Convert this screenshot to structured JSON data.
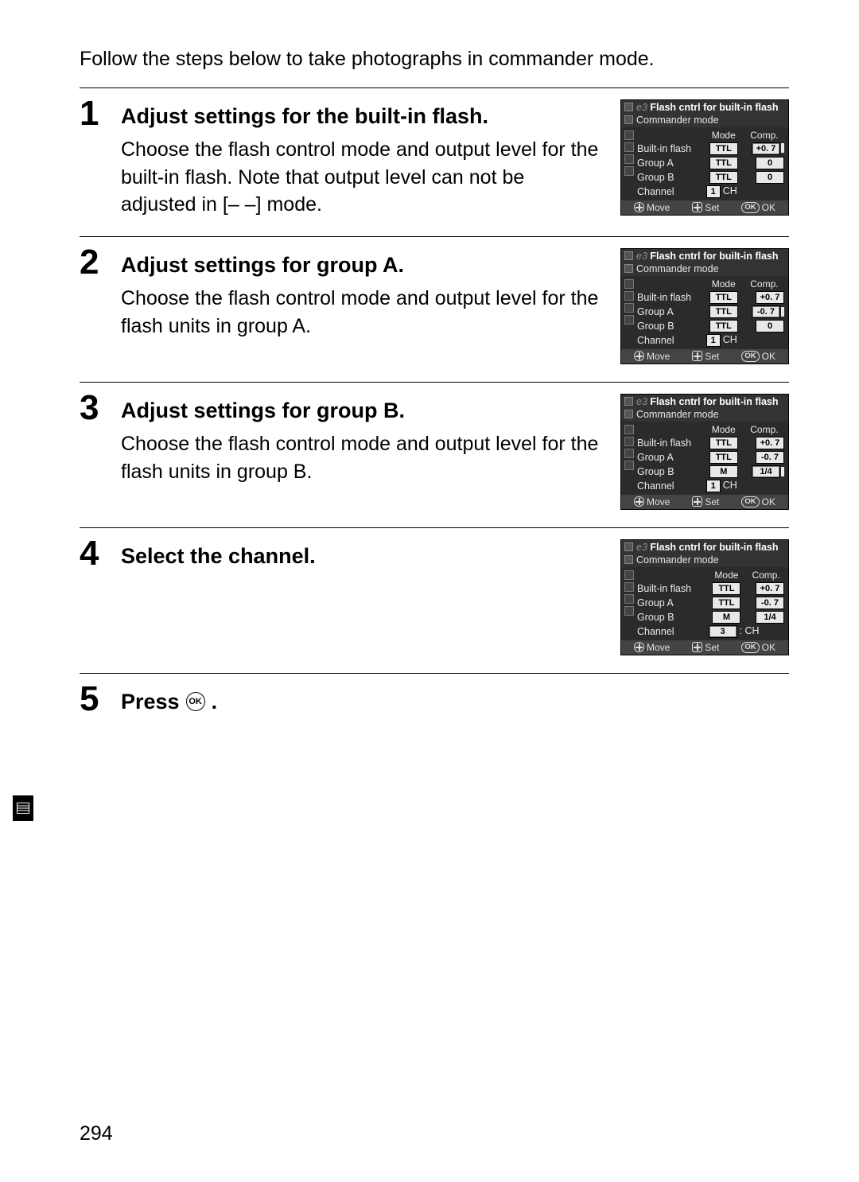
{
  "intro": "Follow the steps below to take photographs in commander mode.",
  "page_number": "294",
  "steps": [
    {
      "num": "1",
      "title": "Adjust settings for the built-in flash.",
      "desc": "Choose the flash control mode and output level for the built-in flash.  Note that output level can not be adjusted in [– –] mode.",
      "menu": {
        "title_prefix": "e3",
        "title_main": "Flash cntrl for built-in flash",
        "crumb": "Commander mode",
        "headers": [
          "Mode",
          "Comp."
        ],
        "rows": [
          {
            "label": "Built-in flash",
            "mode": "TTL",
            "comp": "+0. 7",
            "highlight": "comp",
            "cursor": true
          },
          {
            "label": "Group A",
            "mode": "TTL",
            "comp": "0"
          },
          {
            "label": "Group B",
            "mode": "TTL",
            "comp": "0"
          }
        ],
        "channel_label": "Channel",
        "channel_value": "1",
        "channel_suffix": "CH",
        "status": {
          "move": "Move",
          "set": "Set",
          "ok": "OK"
        }
      }
    },
    {
      "num": "2",
      "title": "Adjust settings for group A.",
      "desc": "Choose the flash control mode and output level for the flash units in group A.",
      "menu": {
        "title_prefix": "e3",
        "title_main": "Flash cntrl for built-in flash",
        "crumb": "Commander mode",
        "headers": [
          "Mode",
          "Comp."
        ],
        "rows": [
          {
            "label": "Built-in flash",
            "mode": "TTL",
            "comp": "+0. 7"
          },
          {
            "label": "Group A",
            "mode": "TTL",
            "comp": "-0. 7",
            "highlight": "comp",
            "cursor": true
          },
          {
            "label": "Group B",
            "mode": "TTL",
            "comp": "0"
          }
        ],
        "channel_label": "Channel",
        "channel_value": "1",
        "channel_suffix": "CH",
        "status": {
          "move": "Move",
          "set": "Set",
          "ok": "OK"
        }
      }
    },
    {
      "num": "3",
      "title": "Adjust settings for group B.",
      "desc": "Choose the flash control mode and output level for the flash units in group B.",
      "menu": {
        "title_prefix": "e3",
        "title_main": "Flash cntrl for built-in flash",
        "crumb": "Commander mode",
        "headers": [
          "Mode",
          "Comp."
        ],
        "rows": [
          {
            "label": "Built-in flash",
            "mode": "TTL",
            "comp": "+0. 7"
          },
          {
            "label": "Group A",
            "mode": "TTL",
            "comp": "-0. 7"
          },
          {
            "label": "Group B",
            "mode": "M",
            "comp": "1/4",
            "highlight": "comp",
            "cursor": true
          }
        ],
        "channel_label": "Channel",
        "channel_value": "1",
        "channel_suffix": "CH",
        "status": {
          "move": "Move",
          "set": "Set",
          "ok": "OK"
        }
      }
    },
    {
      "num": "4",
      "title": "Select the channel.",
      "desc": "",
      "menu": {
        "title_prefix": "e3",
        "title_main": "Flash cntrl for built-in flash",
        "crumb": "Commander mode",
        "headers": [
          "Mode",
          "Comp."
        ],
        "rows": [
          {
            "label": "Built-in flash",
            "mode": "TTL",
            "comp": "+0. 7"
          },
          {
            "label": "Group A",
            "mode": "TTL",
            "comp": "-0. 7"
          },
          {
            "label": "Group B",
            "mode": "M",
            "comp": "1/4"
          }
        ],
        "channel_label": "Channel",
        "channel_value": "3",
        "channel_suffix": ": CH",
        "channel_highlight": true,
        "status": {
          "move": "Move",
          "set": "Set",
          "ok": "OK"
        }
      }
    },
    {
      "num": "5",
      "title_prefix": "Press ",
      "title_suffix": ".",
      "ok_icon_label": "OK",
      "no_menu": true
    }
  ]
}
